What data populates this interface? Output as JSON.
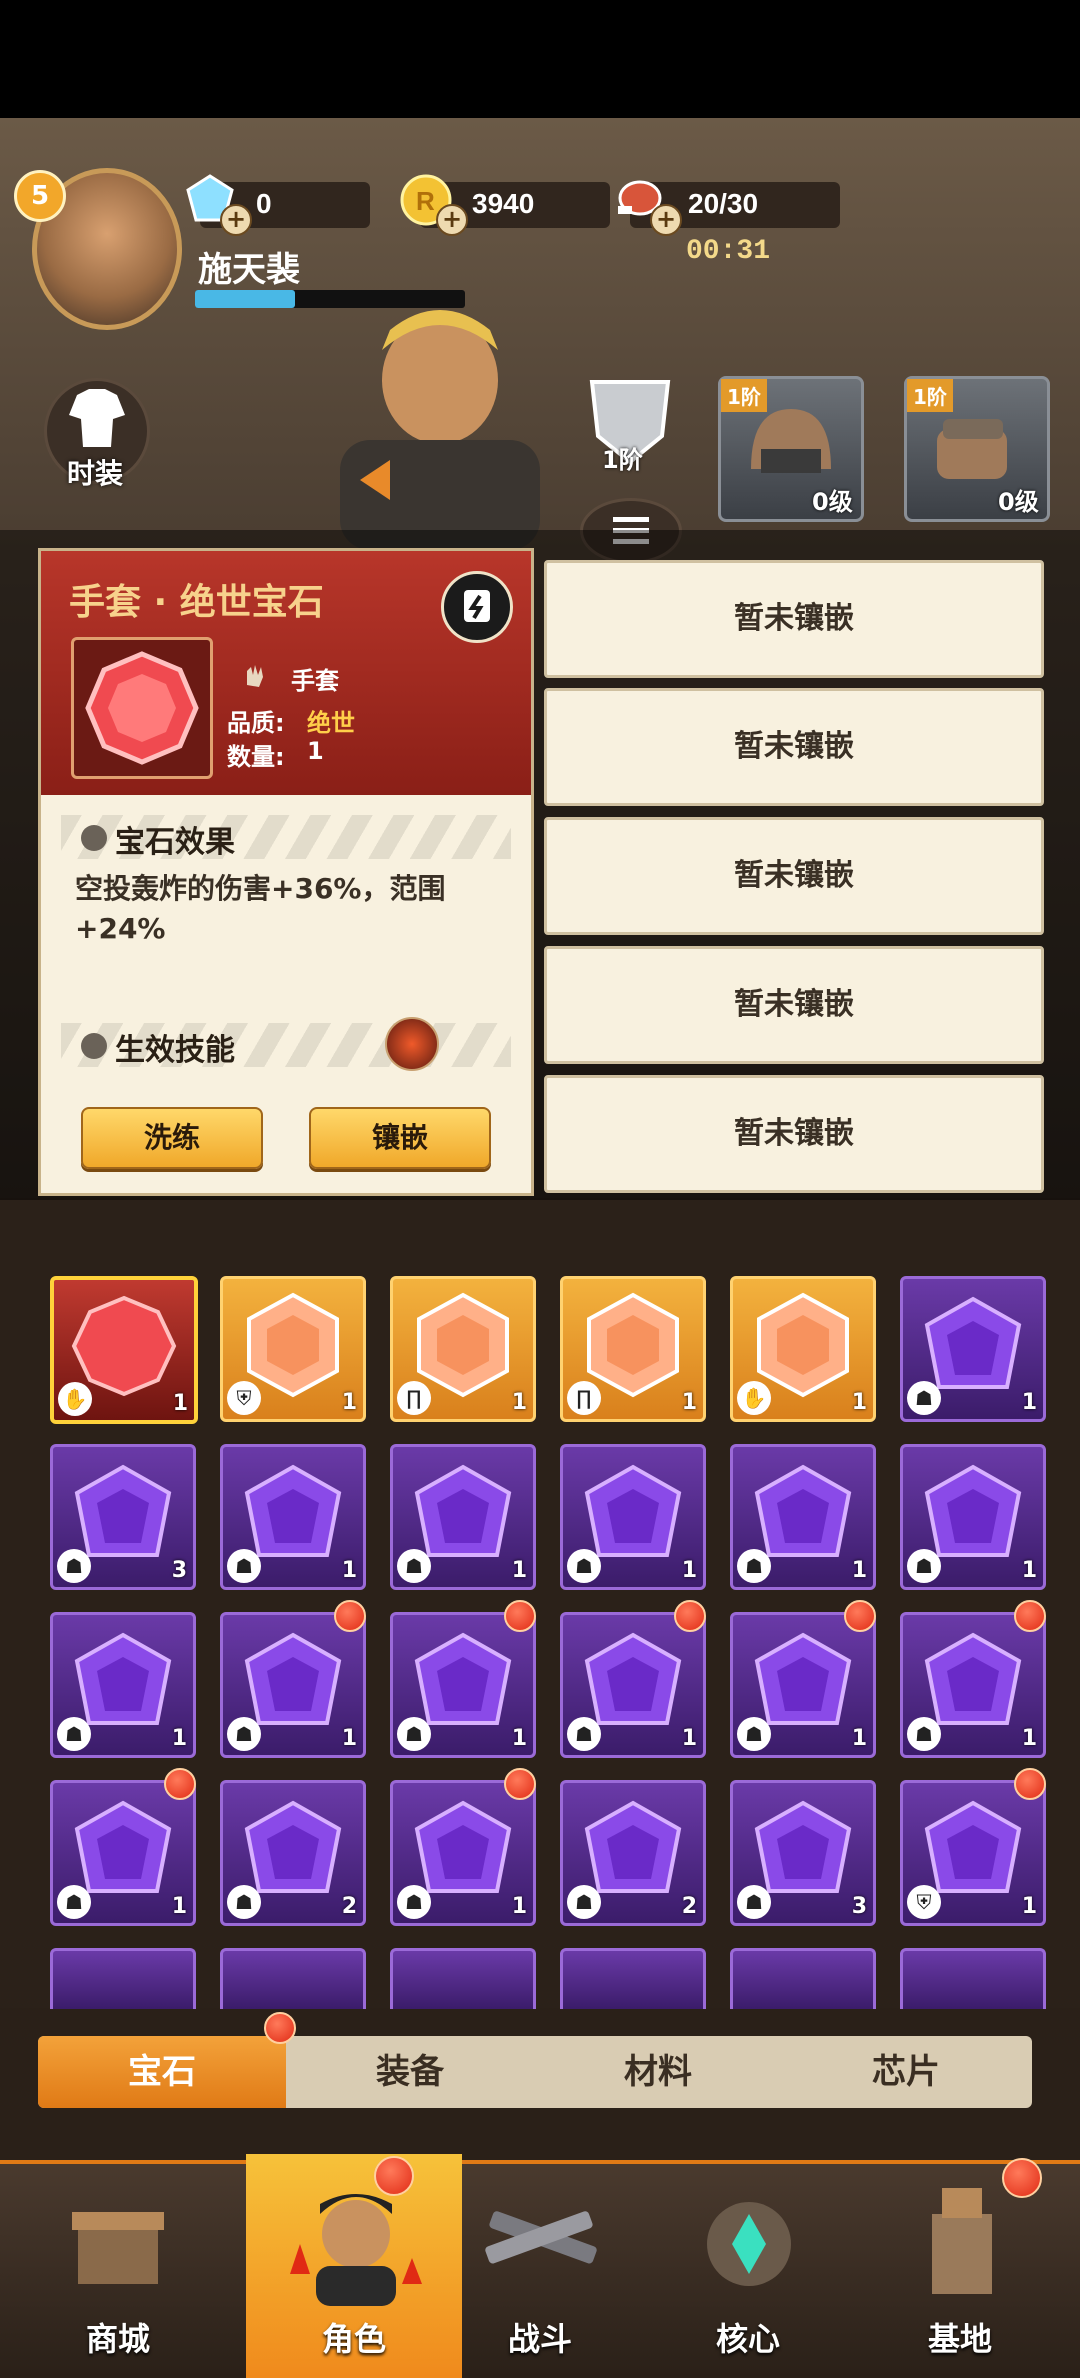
{
  "header": {
    "player_level": "5",
    "player_name": "施天裴",
    "diamonds": "0",
    "coins": "3940",
    "stamina": "20/30",
    "timer": "00:31"
  },
  "side": {
    "costume_label": "时装"
  },
  "equipment": {
    "armor_tier": "1阶",
    "helmet_tier": "1阶",
    "helmet_level": "0级",
    "gloves_tier": "1阶",
    "gloves_level": "0级"
  },
  "gem_panel": {
    "title": "手套 · 绝世宝石",
    "slot_name": "手套",
    "quality_label": "品质:",
    "quality_value": "绝世",
    "quantity_label": "数量:",
    "quantity_value": "1",
    "effect_title": "宝石效果",
    "effect_text": "空投轰炸的伤害+36%，范围+24%",
    "skill_title": "生效技能",
    "refine_button": "洗练",
    "inlay_button": "镶嵌"
  },
  "sockets": [
    "暂未镶嵌",
    "暂未镶嵌",
    "暂未镶嵌",
    "暂未镶嵌",
    "暂未镶嵌"
  ],
  "grid": {
    "rows": [
      [
        {
          "color": "red",
          "count": "1",
          "slot": "glove"
        },
        {
          "color": "orange",
          "count": "1",
          "slot": "armor"
        },
        {
          "color": "orange",
          "count": "1",
          "slot": "pants"
        },
        {
          "color": "orange",
          "count": "1",
          "slot": "pants"
        },
        {
          "color": "orange",
          "count": "1",
          "slot": "glove"
        },
        {
          "color": "purple",
          "count": "1",
          "slot": "helmet"
        }
      ],
      [
        {
          "color": "purple",
          "count": "3",
          "slot": "helmet"
        },
        {
          "color": "purple",
          "count": "1",
          "slot": "helmet"
        },
        {
          "color": "purple",
          "count": "1",
          "slot": "helmet"
        },
        {
          "color": "purple",
          "count": "1",
          "slot": "helmet"
        },
        {
          "color": "purple",
          "count": "1",
          "slot": "helmet"
        },
        {
          "color": "purple",
          "count": "1",
          "slot": "helmet"
        }
      ],
      [
        {
          "color": "purple",
          "count": "1",
          "slot": "helmet"
        },
        {
          "color": "purple",
          "count": "1",
          "slot": "helmet",
          "dot": true
        },
        {
          "color": "purple",
          "count": "1",
          "slot": "helmet",
          "dot": true
        },
        {
          "color": "purple",
          "count": "1",
          "slot": "helmet",
          "dot": true
        },
        {
          "color": "purple",
          "count": "1",
          "slot": "helmet",
          "dot": true
        },
        {
          "color": "purple",
          "count": "1",
          "slot": "helmet",
          "dot": true
        }
      ],
      [
        {
          "color": "purple",
          "count": "1",
          "slot": "helmet",
          "dot": true
        },
        {
          "color": "purple",
          "count": "2",
          "slot": "helmet"
        },
        {
          "color": "purple",
          "count": "1",
          "slot": "helmet",
          "dot": true
        },
        {
          "color": "purple",
          "count": "2",
          "slot": "helmet"
        },
        {
          "color": "purple",
          "count": "3",
          "slot": "helmet"
        },
        {
          "color": "purple",
          "count": "1",
          "slot": "armor",
          "dot": true
        }
      ]
    ]
  },
  "tabs": [
    "宝石",
    "装备",
    "材料",
    "芯片"
  ],
  "nav": [
    "商城",
    "角色",
    "战斗",
    "核心",
    "基地"
  ],
  "colors": {
    "accent_orange": "#e07a16",
    "panel_red": "#b8362a",
    "gem_purple": "#6a3aa8"
  }
}
